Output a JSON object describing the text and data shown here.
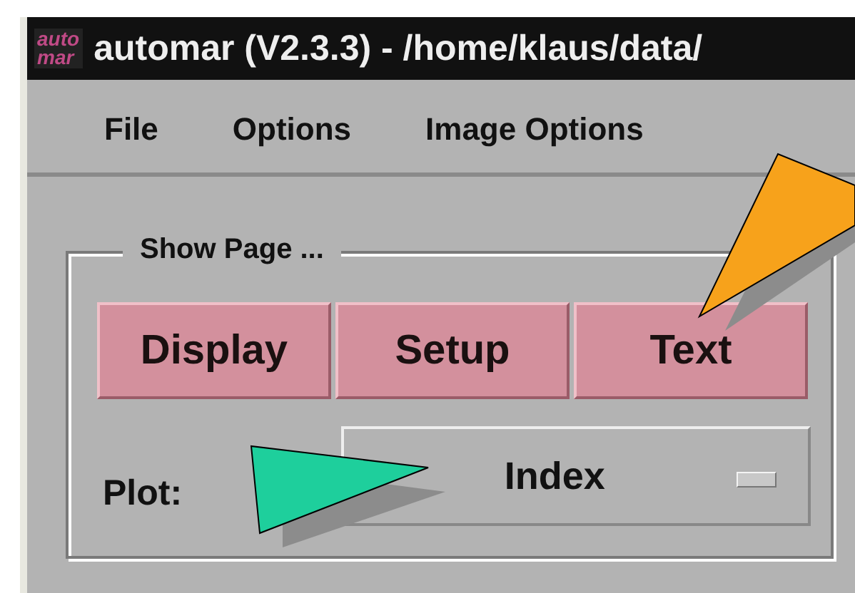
{
  "window": {
    "logo": [
      "auto",
      "mar"
    ],
    "title": "automar (V2.3.3) - /home/klaus/data/"
  },
  "menu": [
    {
      "label": "File"
    },
    {
      "label": "Options"
    },
    {
      "label": "Image Options"
    }
  ],
  "group": {
    "title": "Show Page ...",
    "buttons": [
      {
        "label": "Display"
      },
      {
        "label": "Setup"
      },
      {
        "label": "Text"
      }
    ],
    "plot": {
      "label": "Plot:",
      "value": "Index"
    }
  }
}
